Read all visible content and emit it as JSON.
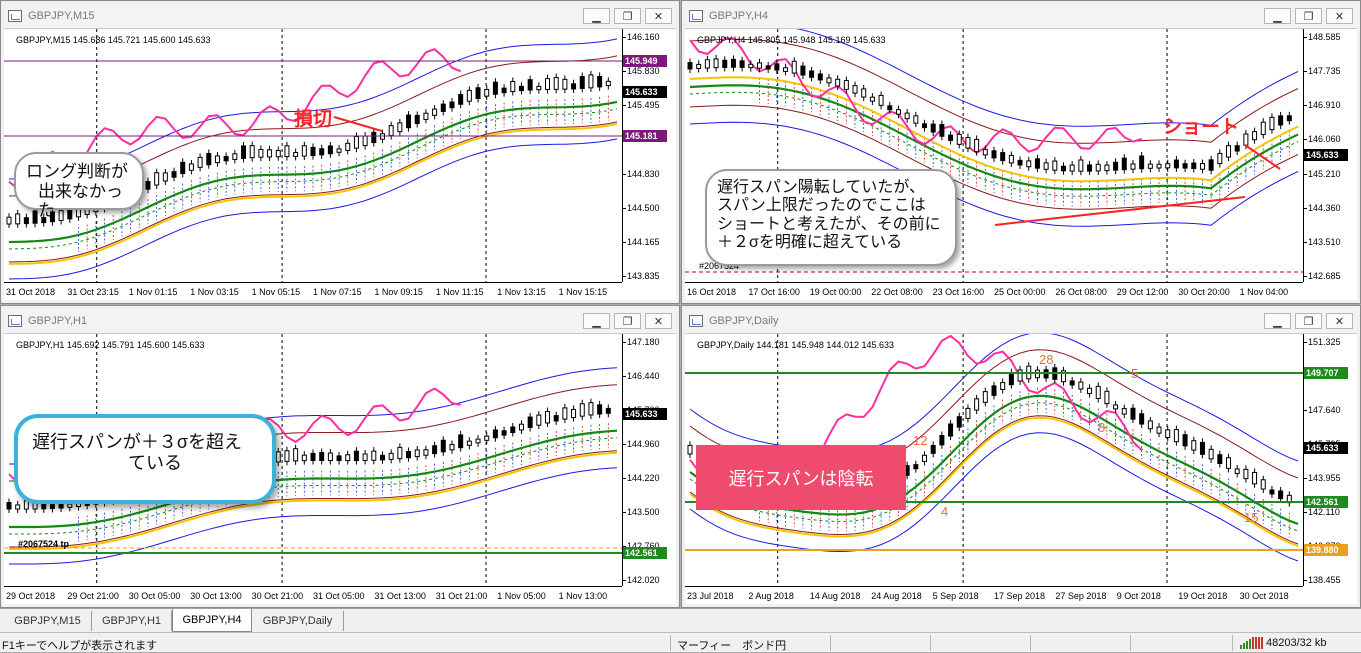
{
  "colors": {
    "candle": "#000000",
    "bb_outer": "#1a1ae6",
    "bb_inner": "#8b1a1a",
    "ichimoku_red": "#d61a1a",
    "ichimoku_blue": "#1a3ad6",
    "chikou": "#ff2e9f",
    "ma_green": "#128a12",
    "ma_yellow": "#f5c400",
    "hline_green": "#1f8a1f",
    "hline_orange": "#e8a020",
    "tag_dark": "#000000",
    "tag_purple": "#7a1a7a",
    "tag_green": "#1f8a1f",
    "tag_orange": "#e8a020",
    "annotation_red": "#ff2222",
    "annotation_pink_box": "#ef4b6f",
    "annotation_orange": "#f26a2e"
  },
  "windows": {
    "m15": {
      "title": "GBPJPY,M15",
      "info": "GBPJPY,M15  145.686 145.721 145.600 145.633",
      "price_ticks": [
        "146.160",
        "145.830",
        "145.495",
        "145.165",
        "144.830",
        "144.500",
        "144.165",
        "143.835"
      ],
      "price_tags": [
        {
          "text": "145.949",
          "color": "#7a1a7a"
        },
        {
          "text": "145.633",
          "color": "#000000"
        },
        {
          "text": "145.181",
          "color": "#7a1a7a"
        }
      ],
      "time_ticks": [
        "31 Oct 2018",
        "31 Oct 23:15",
        "1 Nov 01:15",
        "1 Nov 03:15",
        "1 Nov 05:15",
        "1 Nov 07:15",
        "1 Nov 09:15",
        "1 Nov 11:15",
        "1 Nov 13:15",
        "1 Nov 15:15"
      ],
      "callout": [
        "ロング判断が",
        "出来なかった"
      ],
      "red_label": "損切"
    },
    "h4": {
      "title": "GBPJPY,H4",
      "info": "GBPJPY,H4  145.805 145.948 145.169 145.633",
      "price_ticks": [
        "148.585",
        "147.735",
        "146.910",
        "146.060",
        "145.210",
        "144.360",
        "143.510",
        "142.685"
      ],
      "price_tags": [
        {
          "text": "145.633",
          "color": "#000000"
        }
      ],
      "time_ticks": [
        "16 Oct 2018",
        "17 Oct 16:00",
        "19 Oct 00:00",
        "22 Oct 08:00",
        "23 Oct 16:00",
        "25 Oct 00:00",
        "26 Oct 08:00",
        "29 Oct 12:00",
        "30 Oct 20:00",
        "1 Nov 04:00"
      ],
      "callout": [
        "遅行スパン陽転していたが、",
        "スパン上限だったのでここは",
        "ショートと考えたが、その前に",
        "＋２σを明確に超えている"
      ],
      "red_label": "ショート",
      "order_label": "#2067524"
    },
    "h1": {
      "title": "GBPJPY,H1",
      "info": "GBPJPY,H1  145.692 145.791 145.600 145.633",
      "price_ticks": [
        "147.180",
        "146.440",
        "145.700",
        "144.960",
        "144.220",
        "143.500",
        "142.760",
        "142.020"
      ],
      "price_tags": [
        {
          "text": "145.633",
          "color": "#000000"
        },
        {
          "text": "142.561",
          "color": "#1f8a1f"
        }
      ],
      "time_ticks": [
        "29 Oct 2018",
        "29 Oct 21:00",
        "30 Oct 05:00",
        "30 Oct 13:00",
        "30 Oct 21:00",
        "31 Oct 05:00",
        "31 Oct 13:00",
        "31 Oct 21:00",
        "1 Nov 05:00",
        "1 Nov 13:00"
      ],
      "callout": [
        "遅行スパンが＋３σを超え",
        "ている"
      ],
      "order_label": "#2067524 tp"
    },
    "daily": {
      "title": "GBPJPY,Daily",
      "info": "GBPJPY,Daily  144.181 145.948 144.012 145.633",
      "price_ticks": [
        "151.325",
        "149.480",
        "147.640",
        "145.795",
        "143.955",
        "142.110",
        "140.270",
        "138.455"
      ],
      "price_tags": [
        {
          "text": "149.707",
          "color": "#1f8a1f"
        },
        {
          "text": "145.633",
          "color": "#000000"
        },
        {
          "text": "142.561",
          "color": "#1f8a1f"
        },
        {
          "text": "139.880",
          "color": "#e8a020"
        }
      ],
      "time_ticks": [
        "23 Jul 2018",
        "2 Aug 2018",
        "14 Aug 2018",
        "24 Aug 2018",
        "5 Sep 2018",
        "17 Sep 2018",
        "27 Sep 2018",
        "9 Oct 2018",
        "19 Oct 2018",
        "30 Oct 2018"
      ],
      "pink_box": "遅行スパンは陰転",
      "wave_labels": [
        "28",
        "5",
        "12",
        "4",
        "8",
        "15"
      ]
    }
  },
  "tabs": [
    "GBPJPY,M15",
    "GBPJPY,H1",
    "GBPJPY,H4",
    "GBPJPY,Daily"
  ],
  "active_tab": "GBPJPY,H4",
  "status": {
    "help": "F1キーでヘルプが表示されます",
    "profile": "マーフィー　ボンド円",
    "traffic": "48203/32 kb"
  },
  "icons": {
    "window": "chart-window-icon",
    "minimize": "minimize-icon",
    "restore": "restore-icon",
    "close": "close-icon",
    "connection": "connection-bars-icon"
  }
}
